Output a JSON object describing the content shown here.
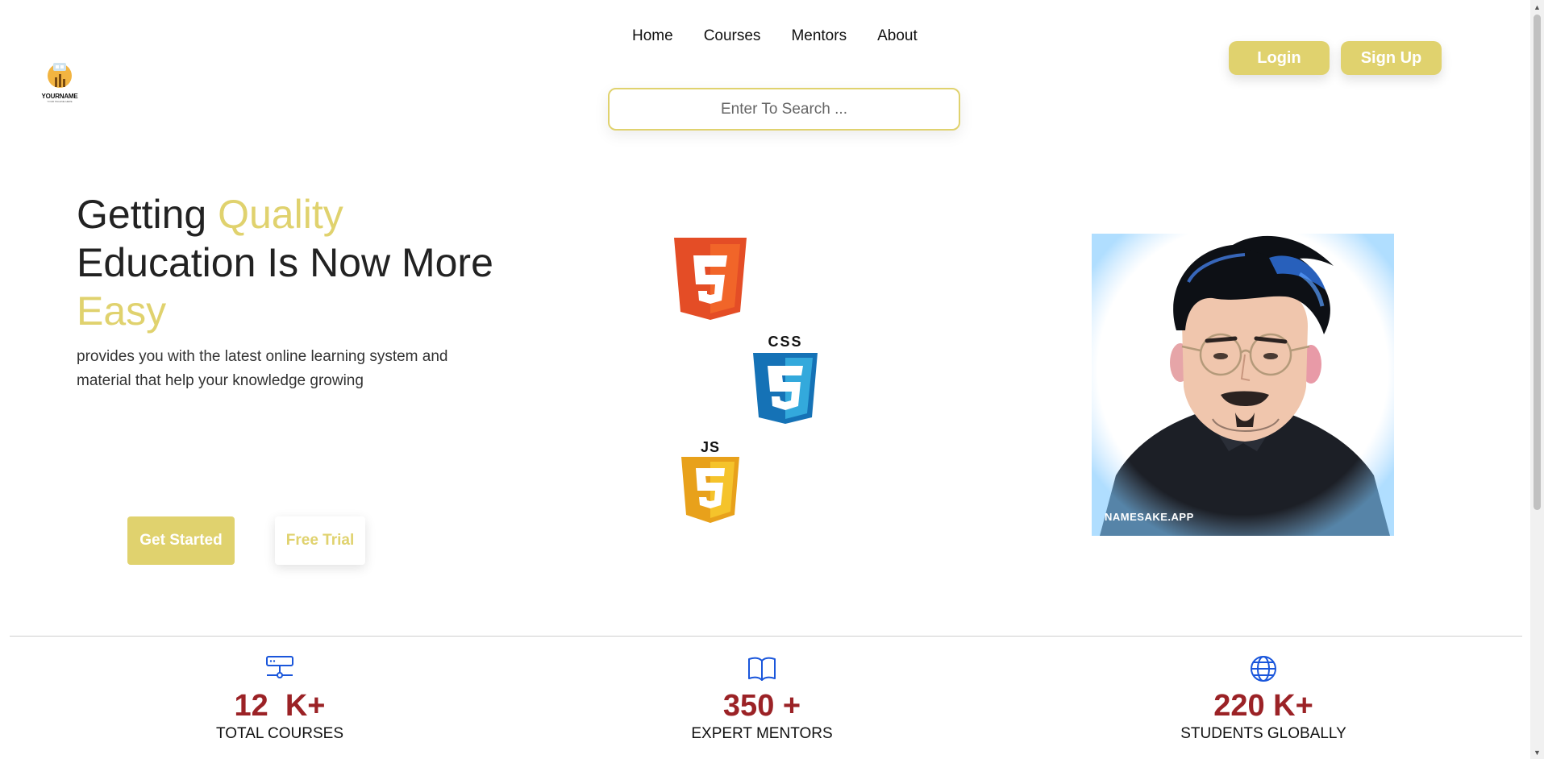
{
  "brand": {
    "name": "YOURNAME",
    "tagline": "YOUR TAGLINE HERE"
  },
  "nav": {
    "items": [
      "Home",
      "Courses",
      "Mentors",
      "About"
    ]
  },
  "auth": {
    "login_label": "Login",
    "signup_label": "Sign Up"
  },
  "search": {
    "placeholder": "Enter To Search ..."
  },
  "hero": {
    "title_part1": "Getting ",
    "title_accent1": "Quality",
    "title_part2": "Education Is Now More ",
    "title_accent2": "Easy",
    "subtitle": "provides you with the latest online learning system and material that help your knowledge growing",
    "get_started_label": "Get Started",
    "free_trial_label": "Free Trial"
  },
  "tech_badges": {
    "css_label": "CSS",
    "js_label": "JS"
  },
  "portrait": {
    "watermark": "NAMESAKE.APP"
  },
  "stats": [
    {
      "icon": "server-icon",
      "value": "12  K+",
      "label": "TOTAL COURSES"
    },
    {
      "icon": "book-icon",
      "value": "350 +",
      "label": "EXPERT MENTORS"
    },
    {
      "icon": "globe-icon",
      "value": "220 K+",
      "label": "STUDENTS GLOBALLY"
    }
  ],
  "colors": {
    "accent": "#e0d26e",
    "stat_number": "#9b2226",
    "icon_blue": "#1a56db"
  }
}
